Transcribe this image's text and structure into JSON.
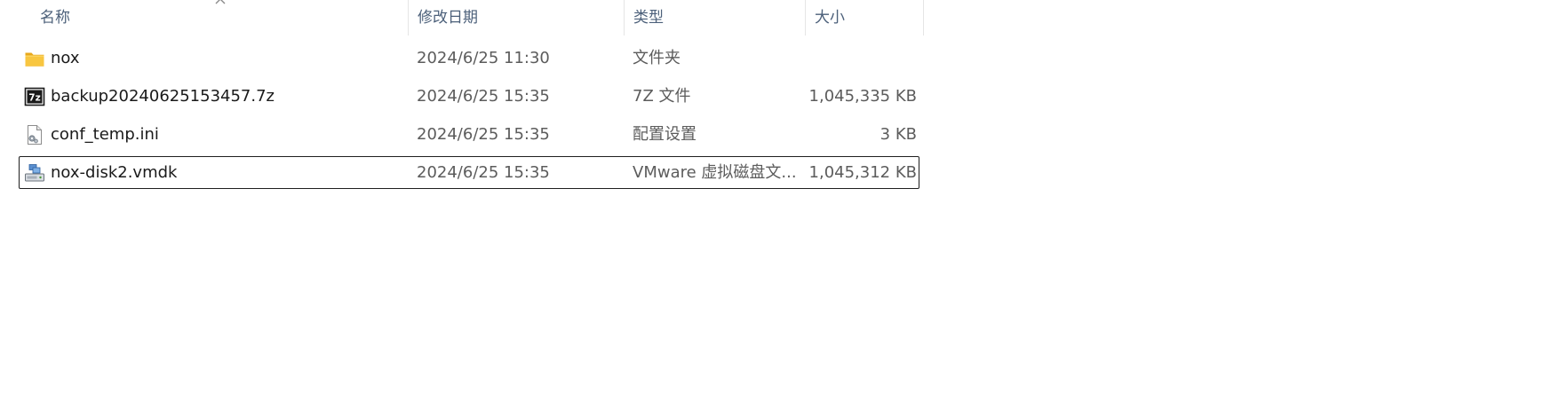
{
  "header": {
    "columns": {
      "name": "名称",
      "date": "修改日期",
      "type": "类型",
      "size": "大小"
    },
    "sort_icon": "chevron-up-icon"
  },
  "files": [
    {
      "name": "nox",
      "date": "2024/6/25 11:30",
      "type": "文件夹",
      "size": "",
      "icon": "folder-icon"
    },
    {
      "name": "backup20240625153457.7z",
      "date": "2024/6/25 15:35",
      "type": "7Z 文件",
      "size": "1,045,335 KB",
      "icon": "7z-archive-icon"
    },
    {
      "name": "conf_temp.ini",
      "date": "2024/6/25 15:35",
      "type": "配置设置",
      "size": "3 KB",
      "icon": "ini-settings-file-icon"
    },
    {
      "name": "nox-disk2.vmdk",
      "date": "2024/6/25 15:35",
      "type": "VMware 虚拟磁盘文...",
      "size": "1,045,312 KB",
      "icon": "vmware-disk-icon",
      "selected": true
    }
  ],
  "colors": {
    "header_text": "#4c607a",
    "folder": "#f8c640",
    "selection_border": "#1f1f1f"
  }
}
